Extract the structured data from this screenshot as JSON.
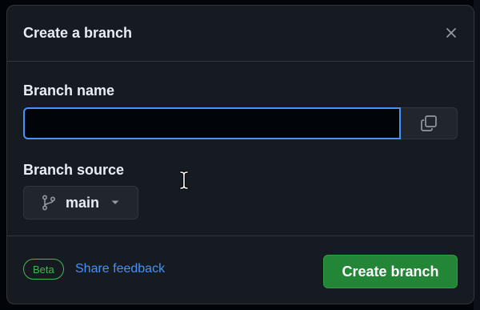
{
  "dialog": {
    "title": "Create a branch",
    "close_icon": "close-icon"
  },
  "form": {
    "branch_name_label": "Branch name",
    "branch_name_value": "",
    "copy_icon": "copy-icon",
    "branch_source_label": "Branch source",
    "branch_source_value": "main",
    "branch_icon": "git-branch-icon",
    "caret_icon": "triangle-down-icon"
  },
  "footer": {
    "badge": "Beta",
    "feedback_link": "Share feedback",
    "create_button": "Create branch"
  },
  "colors": {
    "accent": "#4493f8",
    "primary_button": "#238636",
    "badge": "#3fb950",
    "background": "#161b22"
  }
}
